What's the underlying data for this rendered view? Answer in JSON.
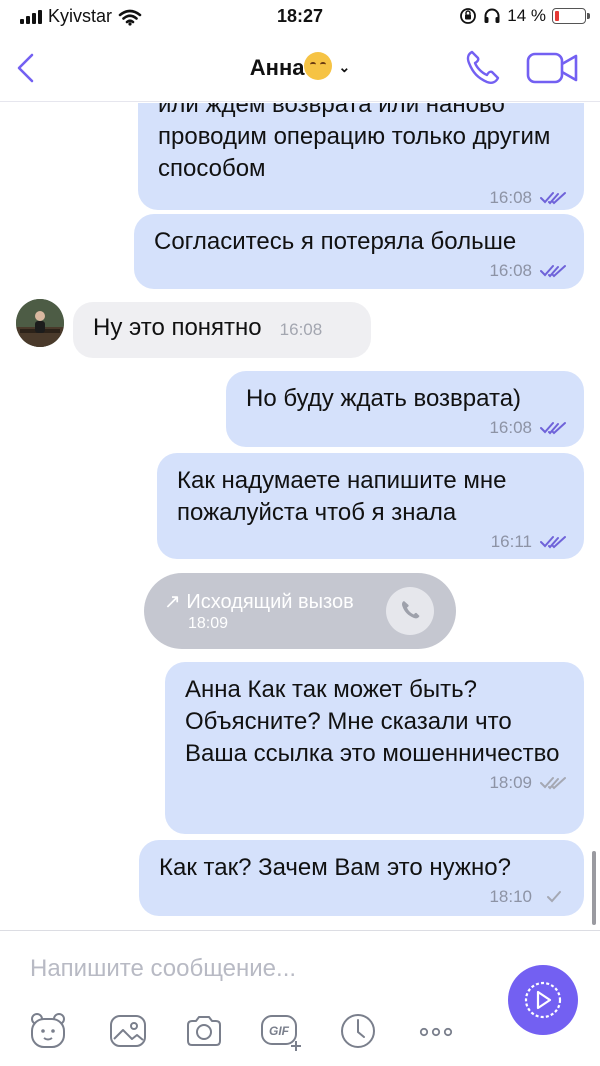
{
  "status_bar": {
    "carrier": "Kyivstar",
    "time": "18:27",
    "battery_percent": "14 %",
    "battery_level": 0.14,
    "battery_color": "#e53935",
    "icons": [
      "signal-icon",
      "wifi-icon",
      "orientation-lock-icon",
      "headphones-icon",
      "battery-icon"
    ]
  },
  "header": {
    "contact_name": "Анна",
    "icons": [
      "back-chevron-icon",
      "smiling-face-with-hearts-emoji",
      "chevron-down-icon",
      "phone-icon",
      "video-camera-icon"
    ]
  },
  "messages": [
    {
      "direction": "out",
      "text": "или ждем возврата или наново проводим операцию только другим способом",
      "time": "16:08",
      "status": "read"
    },
    {
      "direction": "out",
      "text": "Согласитесь я потеряла больше",
      "time": "16:08",
      "status": "read"
    },
    {
      "direction": "in",
      "text": "Ну это понятно",
      "time": "16:08"
    },
    {
      "direction": "out",
      "text": "Но буду ждать возврата)",
      "time": "16:08",
      "status": "read"
    },
    {
      "direction": "out",
      "text": "Как надумаете напишите мне пожалуйста чтоб я знала",
      "time": "16:11",
      "status": "read"
    },
    {
      "direction": "call",
      "text": "Исходящий вызов",
      "time": "18:09",
      "arrow": "↗"
    },
    {
      "direction": "out",
      "text": "Анна Как так может быть? Объясните? Мне сказали что Ваша ссылка это мошенничество",
      "time": "18:09",
      "status": "delivered"
    },
    {
      "direction": "out",
      "text": "Как так? Зачем Вам это нужно?",
      "time": "18:10",
      "status": "sent"
    }
  ],
  "composer": {
    "placeholder": "Напишите сообщение...",
    "tools": [
      "sticker-icon",
      "gallery-icon",
      "camera-icon",
      "gif-icon",
      "timer-icon",
      "more-icon"
    ],
    "send_icon": "send-play-icon"
  },
  "colors": {
    "accent": "#7360f2",
    "outgoing_bubble": "#d5e1fb",
    "incoming_bubble": "#efeff2",
    "read_ticks": "#6f63d9",
    "unread_ticks": "#a5a8b3",
    "call_pill": "#c5c7d0"
  }
}
